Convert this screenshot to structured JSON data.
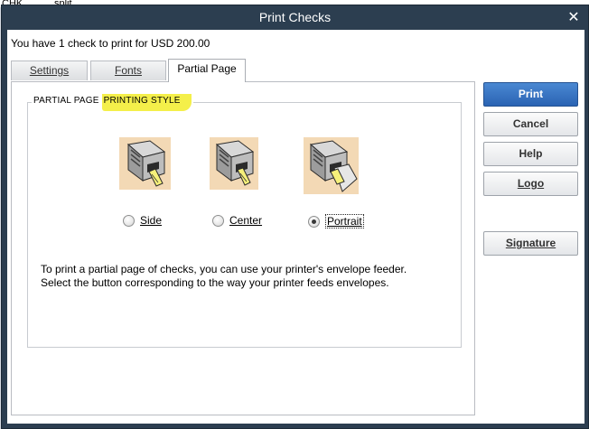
{
  "background": {
    "col1": "CHK",
    "col2": "split"
  },
  "window": {
    "title": "Print Checks"
  },
  "info_text": "You have 1 check to print for USD 200.00",
  "tabs": [
    {
      "label": "Settings",
      "active": false
    },
    {
      "label": "Fonts",
      "active": false
    },
    {
      "label": "Partial Page",
      "active": true
    }
  ],
  "partial_page": {
    "group_title_prefix": "PARTIAL PAGE ",
    "group_title_highlight": "PRINTING STYLE",
    "options": [
      {
        "label": "Side",
        "selected": false,
        "icon": "printer-side-icon"
      },
      {
        "label": "Center",
        "selected": false,
        "icon": "printer-center-icon"
      },
      {
        "label": "Portrait",
        "selected": true,
        "icon": "printer-portrait-icon"
      }
    ],
    "description_line1": "To print a partial page of checks,  you can use your printer's envelope feeder.",
    "description_line2": "Select the button corresponding to the way your printer feeds envelopes."
  },
  "buttons": {
    "print": "Print",
    "cancel": "Cancel",
    "help": "Help",
    "logo": "Logo",
    "signature": "Signature"
  },
  "colors": {
    "titlebar": "#2c3e50",
    "primary_button": "#2f6fc0",
    "highlight": "#f4ef4a",
    "printer_tile": "#f3d9b5"
  }
}
